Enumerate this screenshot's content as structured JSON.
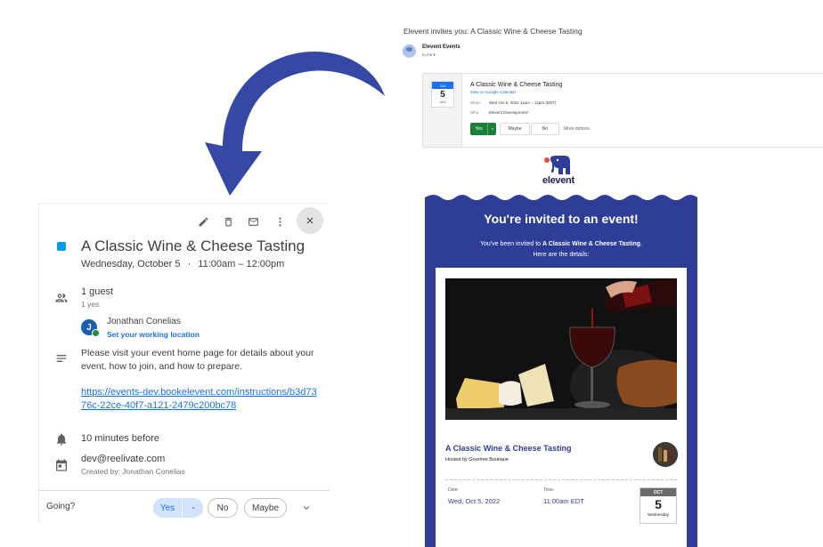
{
  "gcal": {
    "toolbar": {
      "edit_icon": "pencil-icon",
      "delete_icon": "trash-icon",
      "email_icon": "envelope-icon",
      "more_icon": "more-vertical-icon",
      "close_icon": "close-icon"
    },
    "event_color": "#039be5",
    "title": "A Classic Wine & Cheese Tasting",
    "date": "Wednesday, October 5",
    "separator": "·",
    "time": "11:00am – 12:00pm",
    "guests": {
      "count_label": "1 guest",
      "yes_label": "1 yes",
      "guest_name": "Jonathan Conelias",
      "guest_initial": "J",
      "guest_link": "Set your working location"
    },
    "description": "Please visit your event home page for details about your event, how to join, and how to prepare.",
    "description_link": "https://events-dev.bookelevent.com/instructions/b3d7376c-22ce-40f7-a121-2479c200bc78",
    "reminder": "10 minutes before",
    "calendar": {
      "name": "dev@reelivate.com",
      "created_by": "Created by: Jonathan Conelias"
    },
    "footer": {
      "going_label": "Going?",
      "yes": "Yes",
      "no": "No",
      "maybe": "Maybe"
    }
  },
  "gmail": {
    "subject": "Elevent invites you: A Classic Wine & Cheese Tasting",
    "sender": "Elevent Events",
    "to": "to me ▾",
    "cal_month": "Oct",
    "cal_day": "5",
    "cal_weekday": "Wed",
    "title": "A Classic Wine & Cheese Tasting",
    "view_link": "View on Google Calendar",
    "when_label": "When",
    "when_value": "Wed Oct 5, 2022 11am – 12pm (EDT)",
    "who_label": "Who",
    "who_value": "Elevent Development*",
    "yes": "Yes",
    "maybe": "Maybe",
    "no": "No",
    "more": "More options"
  },
  "logo": {
    "text": "elevent"
  },
  "email": {
    "heading": "You're invited to an event!",
    "sub_prefix": "You've been invited to ",
    "sub_event": "A Classic Wine & Cheese Tasting",
    "sub_suffix": ".",
    "sub_line2": "Here are the details:",
    "event_title": "A Classic Wine & Cheese Tasting",
    "host": "Hosted by Gourmet Boutique",
    "date_label": "Date:",
    "date_value": "Wed, Oct 5, 2022",
    "time_label": "Time:",
    "time_value": "11:00am EDT",
    "cal_month": "OCT",
    "cal_day": "5",
    "cal_weekday": "Wednesday",
    "accent": "#2e3d97"
  }
}
